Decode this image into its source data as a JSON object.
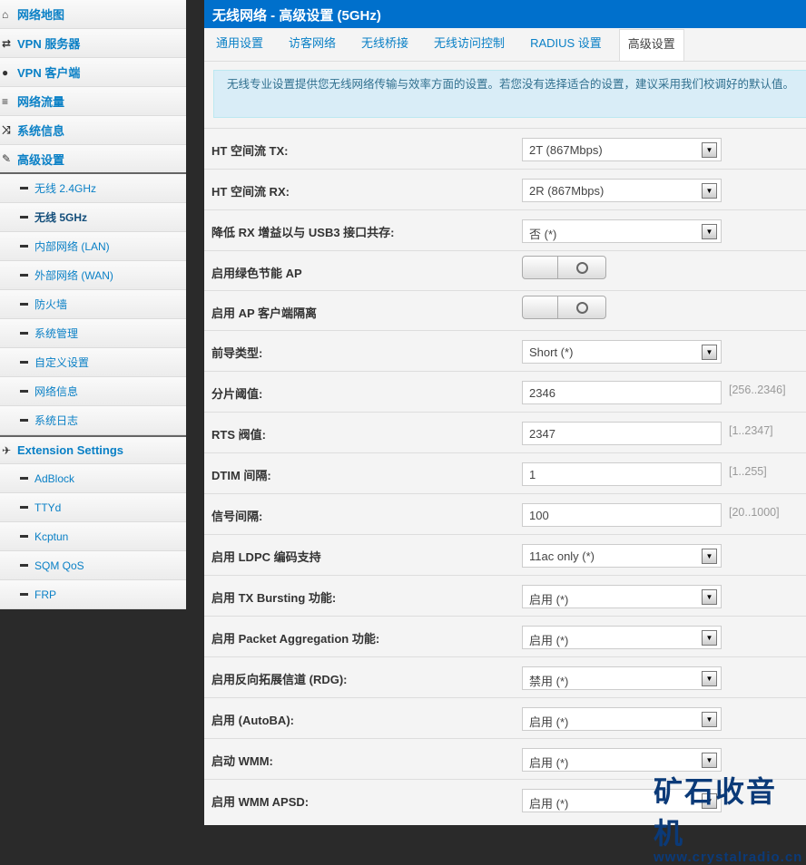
{
  "sidebar": {
    "items": [
      {
        "label": "网络地图",
        "icon": "⌂"
      },
      {
        "label": "VPN 服务器",
        "icon": "⇄"
      },
      {
        "label": "VPN 客户端",
        "icon": "●"
      },
      {
        "label": "网络流量",
        "icon": "≡"
      },
      {
        "label": "系统信息",
        "icon": "⤨"
      },
      {
        "label": "高级设置",
        "icon": "✎"
      }
    ],
    "advanced": [
      "无线 2.4GHz",
      "无线 5GHz",
      "内部网络 (LAN)",
      "外部网络 (WAN)",
      "防火墙",
      "系统管理",
      "自定义设置",
      "网络信息",
      "系统日志"
    ],
    "extension": {
      "label": "Extension Settings",
      "icon": "✈"
    },
    "ext_items": [
      "AdBlock",
      "TTYd",
      "Kcptun",
      "SQM QoS",
      "FRP"
    ]
  },
  "header": {
    "title": "无线网络 - 高级设置 (5GHz)"
  },
  "tabs": [
    "通用设置",
    "访客网络",
    "无线桥接",
    "无线访问控制",
    "RADIUS 设置",
    "高级设置"
  ],
  "info": "无线专业设置提供您无线网络传输与效率方面的设置。若您没有选择适合的设置，建议采用我们校调好的默认值。",
  "rows": [
    {
      "label": "HT 空间流 TX:",
      "type": "select",
      "value": "2T (867Mbps)"
    },
    {
      "label": "HT 空间流 RX:",
      "type": "select",
      "value": "2R (867Mbps)"
    },
    {
      "label": "降低 RX 增益以与 USB3 接口共存:",
      "type": "select",
      "value": "否  (*)"
    },
    {
      "label": "启用绿色节能 AP",
      "type": "switch"
    },
    {
      "label": "启用 AP 客户端隔离",
      "type": "switch"
    },
    {
      "label": "前导类型:",
      "type": "select",
      "value": "Short (*)"
    },
    {
      "label": "分片阈值:",
      "type": "input",
      "value": "2346",
      "hint": "[256..2346]"
    },
    {
      "label": "RTS 阀值:",
      "type": "input",
      "value": "2347",
      "hint": "[1..2347]"
    },
    {
      "label": "DTIM 间隔:",
      "type": "input",
      "value": "1",
      "hint": "[1..255]"
    },
    {
      "label": "信号间隔:",
      "type": "input",
      "value": "100",
      "hint": "[20..1000]"
    },
    {
      "label": "启用 LDPC 编码支持",
      "type": "select",
      "value": "11ac only (*)"
    },
    {
      "label": "启用 TX Bursting 功能:",
      "type": "select",
      "value": "启用  (*)"
    },
    {
      "label": "启用 Packet Aggregation 功能:",
      "type": "select",
      "value": "启用  (*)"
    },
    {
      "label": "启用反向拓展信道 (RDG):",
      "type": "select",
      "value": "禁用  (*)"
    },
    {
      "label": "启用 (AutoBA):",
      "type": "select",
      "value": "启用  (*)"
    },
    {
      "label": "启动 WMM:",
      "type": "select",
      "value": "启用  (*)"
    },
    {
      "label": "启用 WMM APSD:",
      "type": "select",
      "value": "启用  (*)"
    }
  ],
  "watermark": {
    "title": "矿石收音机",
    "url": "www.crystalradio.cn"
  }
}
